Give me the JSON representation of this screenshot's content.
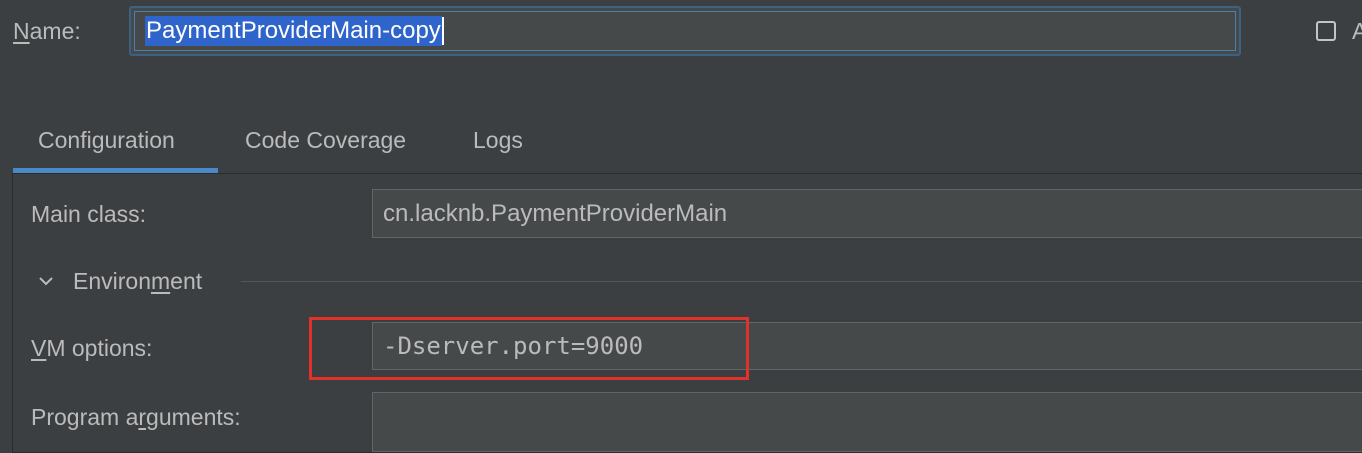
{
  "name_row": {
    "label_prefix": "N",
    "label_rest": "ame:",
    "value": "PaymentProviderMain-copy",
    "checkbox_label": "A"
  },
  "tabs": [
    {
      "label": "Configuration",
      "selected": true
    },
    {
      "label": "Code Coverage",
      "selected": false
    },
    {
      "label": "Logs",
      "selected": false
    }
  ],
  "config": {
    "main_class_label": "Main class:",
    "main_class_value": "cn.lacknb.PaymentProviderMain",
    "environment": {
      "label_before": "Environ",
      "label_mnemonic": "m",
      "label_after": "ent",
      "expanded": true
    },
    "vm_options_label_mnemonic": "V",
    "vm_options_label_rest": "M options:",
    "vm_options_value": "-Dserver.port=9000",
    "program_args_label_before": "Program a",
    "program_args_label_mnemonic": "r",
    "program_args_label_after": "guments:",
    "program_args_value": ""
  },
  "colors": {
    "background": "#3c3f41",
    "field_bg": "#45494a",
    "accent": "#4a88c7",
    "selection": "#2f65ca",
    "highlight_box": "#e0312b"
  },
  "icons": {
    "environment_toggle": "chevron-down-icon"
  }
}
